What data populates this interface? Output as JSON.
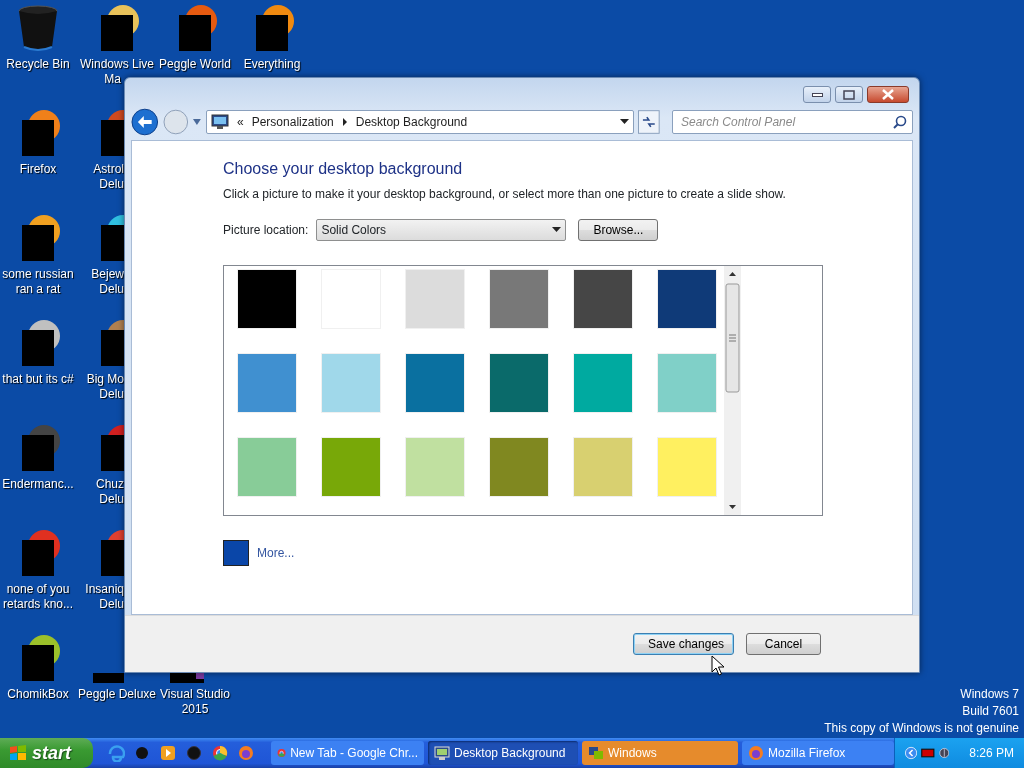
{
  "desktop_icons": [
    {
      "lines": [
        "Recycle Bin"
      ]
    },
    {
      "lines": [
        "Windows Live",
        "Ma"
      ]
    },
    {
      "lines": [
        "Peggle World"
      ]
    },
    {
      "lines": [
        "Everything"
      ]
    },
    {
      "lines": [
        "Firefox"
      ]
    },
    {
      "lines": [
        "Astrol",
        "Delu"
      ]
    },
    {
      "lines": [
        "some russian",
        "ran a rat"
      ]
    },
    {
      "lines": [
        "Bejew",
        "Delu"
      ]
    },
    {
      "lines": [
        "that but its c#"
      ]
    },
    {
      "lines": [
        "Big Mo",
        "Delu"
      ]
    },
    {
      "lines": [
        "Endermanc..."
      ]
    },
    {
      "lines": [
        "Chuz",
        "Delu"
      ]
    },
    {
      "lines": [
        "none of you",
        "retards kno..."
      ]
    },
    {
      "lines": [
        "Insaniq",
        "Delu"
      ]
    },
    {
      "lines": [
        "ChomikBox"
      ]
    },
    {
      "lines": [
        "Peggle Deluxe"
      ]
    },
    {
      "lines": [
        "Visual Studio",
        "2015"
      ]
    }
  ],
  "window": {
    "address": {
      "prefix": "«",
      "crumbs": [
        "Personalization",
        "Desktop Background"
      ]
    },
    "search": {
      "placeholder": "Search Control Panel"
    },
    "heading": "Choose your desktop background",
    "instructions": "Click a picture to make it your desktop background, or select more than one picture to create a slide show.",
    "picture_location": {
      "label": "Picture location:",
      "value": "Solid Colors"
    },
    "browse_button": "Browse...",
    "swatches": [
      {
        "color": "#000000"
      },
      {
        "color": "#ffffff"
      },
      {
        "color": "#dcdcdc"
      },
      {
        "color": "#787878"
      },
      {
        "color": "#464646"
      },
      {
        "color": "#0f3a78"
      },
      {
        "color": "#4090d0"
      },
      {
        "color": "#a0d8ea"
      },
      {
        "color": "#0a70a0"
      },
      {
        "color": "#0a6a6a"
      },
      {
        "color": "#00aaa0"
      },
      {
        "color": "#80d0c8"
      },
      {
        "color": "#88cc98"
      },
      {
        "color": "#78a808"
      },
      {
        "color": "#c0e0a0"
      },
      {
        "color": "#808820"
      },
      {
        "color": "#d8d070"
      },
      {
        "color": "#fff060"
      }
    ],
    "more": {
      "color": "#0a46a8",
      "label": "More..."
    },
    "buttons": [
      {
        "label": "Save changes",
        "default": true
      },
      {
        "label": "Cancel",
        "default": false
      }
    ]
  },
  "desktop_notice": [
    "Windows 7",
    "Build 7601",
    "This copy of Windows is not genuine"
  ],
  "taskbar": {
    "start": "start",
    "tasks": [
      {
        "label": "New Tab - Google Chr...",
        "active": false,
        "flashing": false
      },
      {
        "label": "Desktop Background",
        "active": true,
        "flashing": false
      },
      {
        "label": "Windows",
        "active": false,
        "flashing": true
      },
      {
        "label": "Mozilla Firefox",
        "active": false,
        "flashing": false
      }
    ],
    "clock": "8:26 PM"
  }
}
